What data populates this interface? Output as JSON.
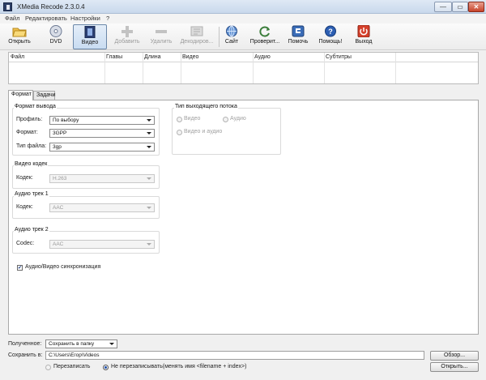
{
  "window": {
    "title": "XMedia Recode 2.3.0.4",
    "min": "—",
    "max": "▭",
    "close": "✕"
  },
  "menu": [
    "Файл",
    "Редактировать",
    "Настройки",
    "?"
  ],
  "toolbar": [
    {
      "label": "Открыть",
      "icon": "open-folder-icon",
      "enabled": true
    },
    {
      "label": "DVD",
      "icon": "dvd-disc-icon",
      "enabled": true
    },
    {
      "label": "Видео",
      "icon": "video-film-icon",
      "enabled": true,
      "active": true
    },
    {
      "label": "Добавить",
      "icon": "plus-icon",
      "enabled": false
    },
    {
      "label": "Удалить",
      "icon": "minus-icon",
      "enabled": false
    },
    {
      "label": "Декодиров...",
      "icon": "decode-icon",
      "enabled": false
    },
    {
      "label": "Сайт",
      "icon": "globe-icon",
      "enabled": true
    },
    {
      "label": "Проверит...",
      "icon": "refresh-icon",
      "enabled": true
    },
    {
      "label": "Помочь",
      "icon": "donate-icon",
      "enabled": true
    },
    {
      "label": "Помощь!",
      "icon": "help-icon",
      "enabled": true
    },
    {
      "label": "Выход",
      "icon": "power-icon",
      "enabled": true
    }
  ],
  "file_table": {
    "columns": [
      "Файл",
      "Главы",
      "Длина",
      "Видео",
      "Аудио",
      "Субтитры"
    ],
    "rows": []
  },
  "tabs": [
    "Формат",
    "Задачи"
  ],
  "format": {
    "output_group": "Формат вывода",
    "profile_label": "Профиль:",
    "profile_value": "По выбору",
    "format_label": "Формат:",
    "format_value": "3GPP",
    "filetype_label": "Тип файла:",
    "filetype_value": "3gp"
  },
  "stream_type": {
    "group": "Тип выходящего потока",
    "video": "Видео",
    "audio": "Аудио",
    "video_audio": "Видео и аудио"
  },
  "video_codec": {
    "group": "Видео кодек",
    "label": "Кодек:",
    "value": "H.263"
  },
  "audio_track1": {
    "group": "Аудио трек 1",
    "label": "Кодек:",
    "value": "AAC"
  },
  "audio_track2": {
    "group": "Аудио трек 2",
    "label": "Codec:",
    "value": "AAC"
  },
  "sync": {
    "label": "Аудио/Видео синхронизация",
    "checked": true
  },
  "bottom": {
    "received_label": "Полученное:",
    "received_value": "Сохранить в папку",
    "save_label": "Сохранить в:",
    "save_path": "C:\\Users\\Егор\\Videos",
    "browse": "Обзор...",
    "overwrite": "Перезаписать",
    "no_overwrite": "Не перезаписывать(менять имя <filename + index>)",
    "open": "Открыть..."
  }
}
